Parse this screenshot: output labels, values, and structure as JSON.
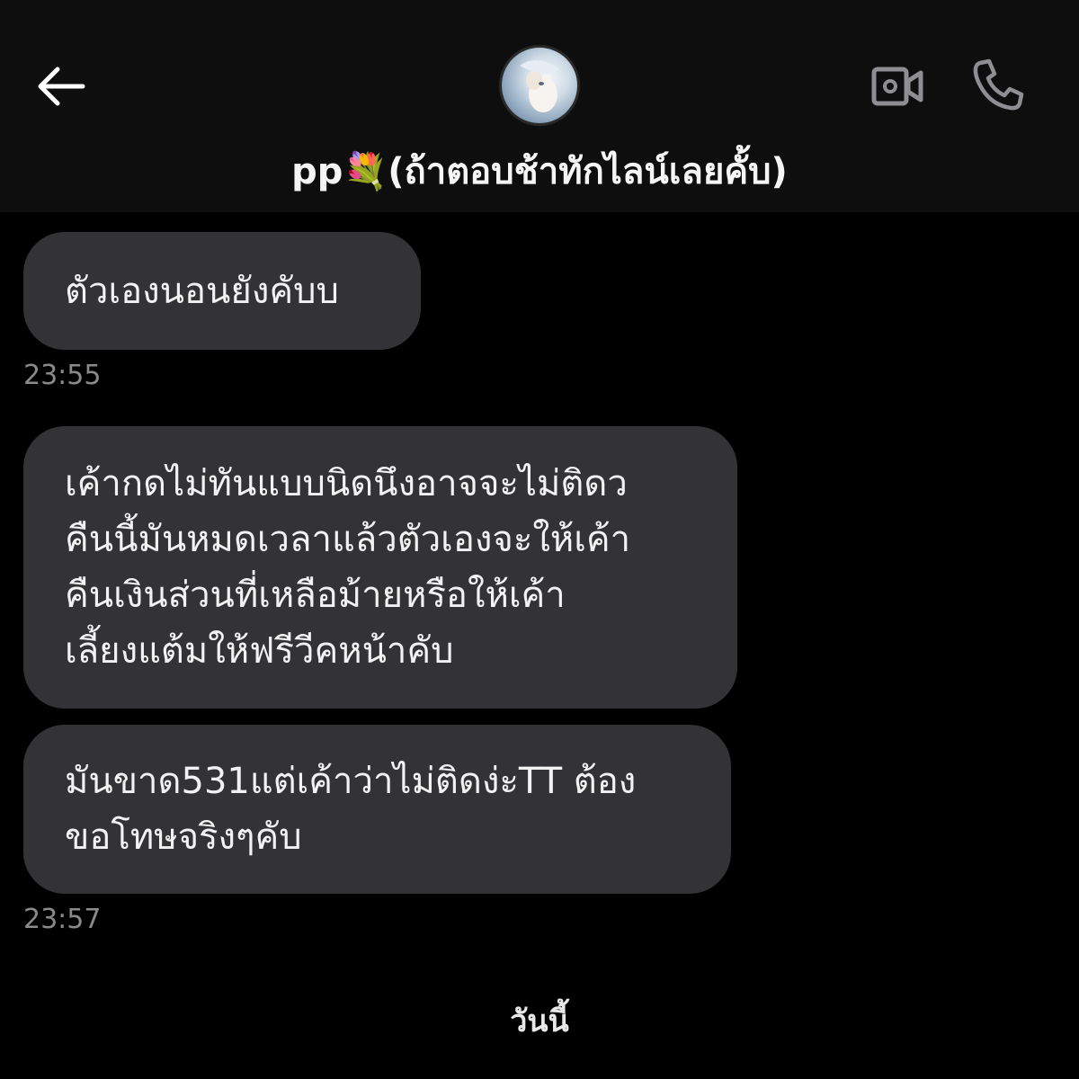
{
  "header": {
    "contact_name": "pp💐(ถ้าตอบช้าทักไลน์เลยคั้บ)",
    "back_icon": "arrow-left-icon",
    "video_icon": "video-call-icon",
    "call_icon": "phone-icon"
  },
  "messages": [
    {
      "text": "ตัวเองนอนยังคับบ",
      "time": "23:55"
    },
    {
      "text": "เค้ากดไม่ทันแบบนิดนึงอาจจะไม่ติดว\nคืนนี้มันหมดเวลาแล้วตัวเองจะให้เค้า\nคืนเงินส่วนที่เหลือม้ายหรือให้เค้า\nเลี้ยงแต้มให้ฟรีวีคหน้าคับ"
    },
    {
      "text": "มันขาด531แต่เค้าว่าไม่ติดง่ะTT ต้อง\nขอโทษจริงๆคับ",
      "time": "23:57"
    }
  ],
  "date_separator": "วันนี้",
  "colors": {
    "background": "#000000",
    "header_background": "#0e0e0e",
    "bubble": "#333335",
    "icon": "#8e8e93",
    "timestamp": "#8a8a8c"
  }
}
